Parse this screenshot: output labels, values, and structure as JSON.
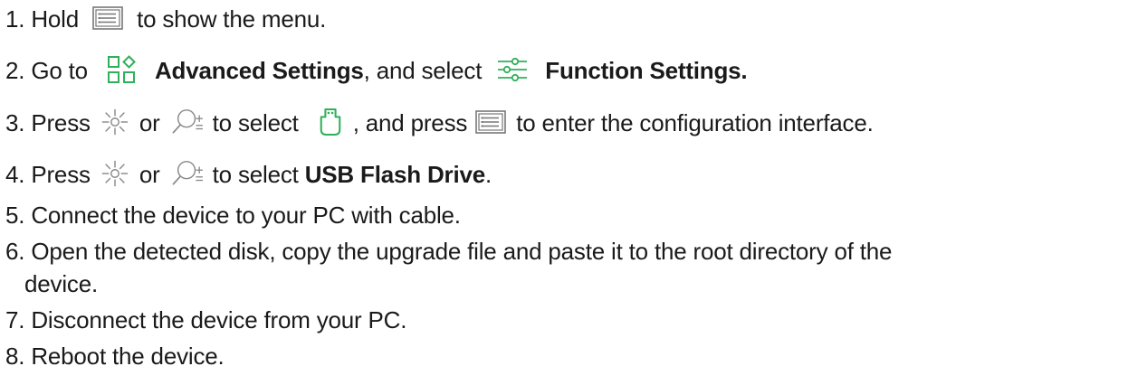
{
  "steps": [
    {
      "parts": {
        "num": "1.",
        "t1": "Hold",
        "t2": "to show the menu."
      },
      "icons": [
        "menu-icon"
      ]
    },
    {
      "parts": {
        "num": "2.",
        "t1": "Go to",
        "b1": "Advanced Settings",
        "t2": ", and select",
        "b2": "Function Settings."
      },
      "icons": [
        "advanced-settings-icon",
        "function-settings-icon"
      ]
    },
    {
      "parts": {
        "num": "3.",
        "t1": "Press",
        "t2": "or",
        "t3": "to select",
        "t4": ", and press",
        "t5": "to enter the configuration interface."
      },
      "icons": [
        "brightness-icon",
        "zoom-icon",
        "usb-icon",
        "menu-icon"
      ]
    },
    {
      "parts": {
        "num": "4.",
        "t1": "Press",
        "t2": "or",
        "t3": "to select",
        "b1": "USB Flash Drive",
        "t4": "."
      },
      "icons": [
        "brightness-icon",
        "zoom-icon"
      ]
    },
    {
      "parts": {
        "num": "5.",
        "t1": "Connect the device to your PC with cable."
      }
    },
    {
      "parts": {
        "num": "6.",
        "t1": "Open the detected disk, copy the upgrade file and paste it to the root directory of the",
        "t2": "device."
      }
    },
    {
      "parts": {
        "num": "7.",
        "t1": "Disconnect the device from your PC."
      }
    },
    {
      "parts": {
        "num": "8.",
        "t1": "Reboot the device."
      }
    }
  ],
  "colors": {
    "text": "#1a1a1a",
    "icon_stroke": "#777777",
    "accent_green": "#2fb05a"
  }
}
